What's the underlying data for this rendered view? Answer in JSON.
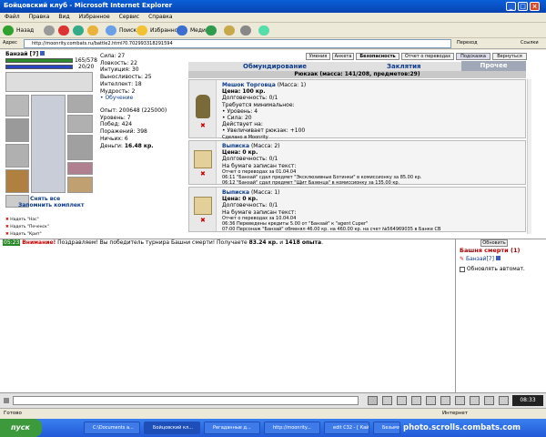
{
  "window": {
    "title": "Бойцовский клуб - Microsoft Internet Explorer"
  },
  "menu": [
    "Файл",
    "Правка",
    "Вид",
    "Избранное",
    "Сервис",
    "Справка"
  ],
  "toolbar": {
    "back": "Назад",
    "search": "Поиск",
    "favorites": "Избранное",
    "media": "Медиа",
    "go": "Переход",
    "links": "Ссылки"
  },
  "address": {
    "label": "Адрес",
    "url": "http://moonrity.combats.ru/battle2.html?0.702993318291594"
  },
  "char": {
    "name": "Банзай",
    "level": "[7]",
    "hp": "165/578",
    "mana": "20/20",
    "unequip": "Снять все",
    "remember": "Запомнить комплект",
    "kits": [
      "Надеть \"Нас\"",
      "Надеть \"Печенск\"",
      "Надеть \"Крит\""
    ]
  },
  "stats": {
    "lines": [
      "Сила: 27",
      "Ловкость: 22",
      "Интуиция: 30",
      "Выносливость: 25",
      "Интеллект: 18",
      "Мудрость: 2"
    ],
    "training": "• Обучение",
    "exp": "Опыт: 200648 (225000)",
    "level": "Уровень: 7",
    "wins": "Побед: 424",
    "losses": "Поражений: 398",
    "draws": "Ничьих: 6",
    "money_label": "Деньги:",
    "money": "16.48 кр."
  },
  "topbuttons": [
    "Умения",
    "Анкета",
    "Безопасность",
    "Отчет о переводах",
    "Подсказка",
    "Вернуться"
  ],
  "tabs": {
    "t1": "Обмундирование",
    "t2": "Заклятия",
    "t3": "Прочее"
  },
  "backpack": "Рюкзак (масса: 141/208, предметов:29)",
  "items": [
    {
      "name": "Мешок Торговца",
      "mass": "(Масса: 1)",
      "price": "Цена: 100 кр.",
      "lines": [
        "Долговечность: 0/1",
        "Требуется минимальное:",
        "• Уровень: 4",
        "• Сила: 20",
        "Действует на:",
        "• Увеличивает рюкзак: +100"
      ],
      "foot": "Сделано в Moonrity"
    },
    {
      "name": "Выписка",
      "mass": "(Масса: 2)",
      "price": "Цена: 0 кр.",
      "lines": [
        "Долговечность: 0/1",
        "На бумаге записан текст:"
      ],
      "notes": [
        "Отчет о переводах за 01.04.04",
        "06:11 \"Банзай\" сдал предмет \"Эксклюзивные Ботинки\" в комиссионку за 85.00 кр.",
        "06:12 \"Банзай\" сдал предмет \"Щит Базенца\" в комиссионку за 135.00 кр."
      ]
    },
    {
      "name": "Выписка",
      "mass": "(Масса: 1)",
      "price": "Цена: 0 кр.",
      "lines": [
        "Долговечность: 0/1",
        "На бумаге записан текст:"
      ],
      "notes": [
        "Отчет о переводах за 10.04.04",
        "06:36 Переведены кредиты 5.00 от \"Банзай\" к \"agent Cuper\"",
        "07:00 Персонаж \"Банзай\" обменял 46.00 кр. на 460.00 кр. на счет №564969035 в Банке CB"
      ]
    }
  ],
  "chat": {
    "time": "05:23",
    "text1": "Внимание!",
    "text2": " Поздравляем! Вы победитель турнира Башни смерти! Получаете ",
    "amount": "83.24 кр.",
    "text3": " и ",
    "exp": "1418 опыта",
    "text4": "."
  },
  "side": {
    "refresh": "Обновить",
    "tower": "Башня смерти (1)",
    "player": "Банзай",
    "plevel": "[7]",
    "auto": "Обновлять автомат."
  },
  "status": {
    "done": "Готово",
    "zone": "Интернет"
  },
  "taskbar": {
    "start": "пуск",
    "tasks": [
      "C:\\Documents a...",
      "Бойцовский кл...",
      "Регаданные д...",
      "http://moonrity...",
      "edit C32 - [ Кай...",
      "Безымянный - ..."
    ],
    "clock": "08:33",
    "watermark": "photo.scrolls.combats.com"
  },
  "colors": {
    "hp": "#2b8a2b",
    "mana": "#2a45c0",
    "accent": "#0b3a8c"
  }
}
